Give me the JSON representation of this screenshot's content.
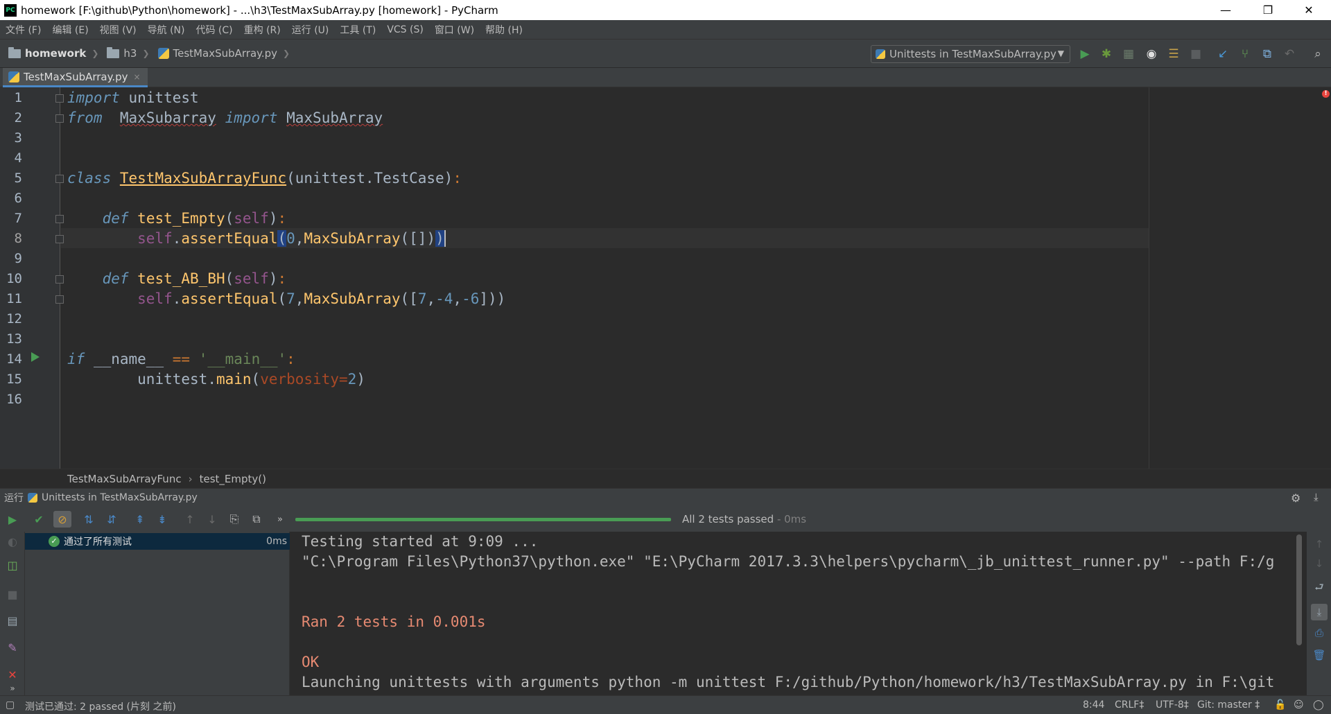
{
  "window": {
    "title": "homework [F:\\github\\Python\\homework] - ...\\h3\\TestMaxSubArray.py [homework] - PyCharm",
    "app_icon": "PC",
    "controls": [
      "—",
      "❐",
      "✕"
    ]
  },
  "menu": [
    "文件 (F)",
    "编辑 (E)",
    "视图 (V)",
    "导航 (N)",
    "代码 (C)",
    "重构 (R)",
    "运行 (U)",
    "工具 (T)",
    "VCS (S)",
    "窗口 (W)",
    "帮助 (H)"
  ],
  "nav": {
    "project": "homework",
    "folder": "h3",
    "file": "TestMaxSubArray.py",
    "run_config": "Unittests in TestMaxSubArray.py"
  },
  "tab": {
    "label": "TestMaxSubArray.py",
    "close": "×"
  },
  "editor": {
    "line_numbers": [
      "1",
      "2",
      "3",
      "4",
      "5",
      "6",
      "7",
      "8",
      "9",
      "10",
      "11",
      "12",
      "13",
      "14",
      "15",
      "16"
    ],
    "current_line": "8",
    "breadcrumb": [
      "TestMaxSubArrayFunc",
      "test_Empty()"
    ],
    "crumb_sep": "›",
    "code": {
      "l1": {
        "kw": "import",
        "rest": " unittest"
      },
      "l2": {
        "kw1": "from",
        "mod": "MaxSubarray",
        "kw2": "import",
        "name": "MaxSubArray"
      },
      "l5": {
        "kw": "class",
        "name": "TestMaxSubArrayFunc",
        "args": "(unittest.TestCase)",
        "colon": ":"
      },
      "l7": {
        "kw": "def",
        "name": "test_Empty",
        "p1": "(",
        "self": "self",
        "p2": ")",
        "colon": ":"
      },
      "l8": {
        "self": "self",
        "dot": ".",
        "method": "assertEqual",
        "po": "(",
        "zero": "0",
        "comma": ",",
        "fn": "MaxSubArray",
        "args": "([])",
        "pc": ")"
      },
      "l10": {
        "kw": "def",
        "name": "test_AB_BH",
        "p1": "(",
        "self": "self",
        "p2": ")",
        "colon": ":"
      },
      "l11": {
        "self": "self",
        "dot": ".",
        "method": "assertEqual",
        "po": "(",
        "seven": "7",
        "comma": ",",
        "fn": "MaxSubArray",
        "open": "([",
        "a": "7",
        "c1": ",",
        "b": "-4",
        "c2": ",",
        "c": "-6",
        "close": "]))"
      },
      "l14": {
        "kw": "if",
        "name": "__name__",
        "op": "==",
        "str": "'__main__'",
        "colon": ":"
      },
      "l15": {
        "obj": "unittest",
        "dot": ".",
        "method": "main",
        "po": "(",
        "param": "verbosity",
        "eq": "=",
        "val": "2",
        "pc": ")"
      }
    }
  },
  "run": {
    "header_label": "运行",
    "config": "Unittests in TestMaxSubArray.py",
    "status_text": "All 2 tests passed",
    "status_time": " - 0ms",
    "progress_fraction": 1.0,
    "tree_item": "通过了所有测试",
    "tree_time": "0ms",
    "console": {
      "line1": "Testing started at 9:09 ...",
      "line2": "\"C:\\Program Files\\Python37\\python.exe\" \"E:\\PyCharm 2017.3.3\\helpers\\pycharm\\_jb_unittest_runner.py\" --path F:/g",
      "line3": "Ran 2 tests in 0.001s",
      "line4": "OK",
      "line5": "Launching unittests with arguments python -m unittest F:/github/Python/homework/h3/TestMaxSubArray.py in F:\\git"
    }
  },
  "statusbar": {
    "message": "测试已通过: 2 passed (片刻 之前)",
    "position": "8:44",
    "line_sep": "CRLF‡",
    "encoding": "UTF-8‡",
    "vcs": "Git: master ‡"
  },
  "colors": {
    "background": "#2b2b2b",
    "panel": "#3c3f41",
    "keyword": "#cc7832",
    "string": "#6a8759",
    "number": "#6897bb",
    "function": "#ffc66d",
    "self": "#94558d",
    "pass_green": "#499c54",
    "console_error": "#e78a72"
  }
}
